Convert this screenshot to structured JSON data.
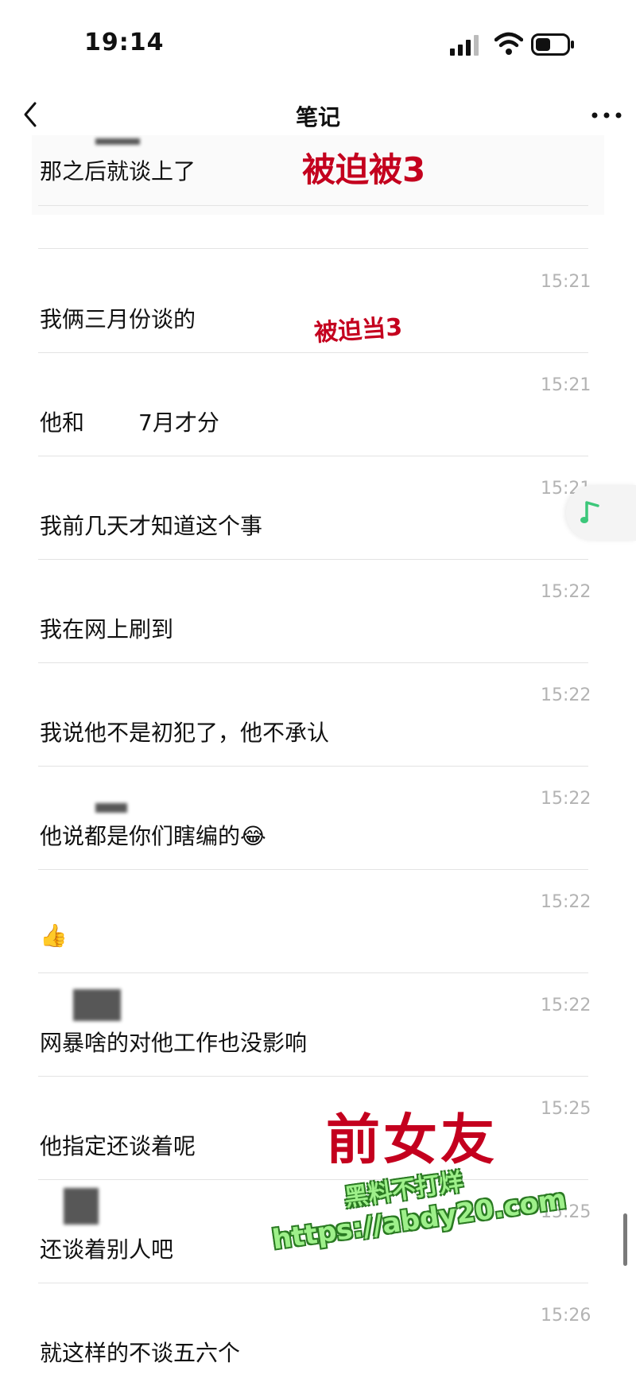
{
  "status": {
    "time": "19:14"
  },
  "nav": {
    "title": "笔记"
  },
  "top_message": {
    "text": "那之后就谈上了"
  },
  "messages": [
    {
      "time": "15:21",
      "text": "我俩三月份谈的"
    },
    {
      "time": "15:21",
      "text": "他和",
      "text_after": "7月才分"
    },
    {
      "time": "15:21",
      "text": "我前几天才知道这个事"
    },
    {
      "time": "15:22",
      "text": "我在网上刷到"
    },
    {
      "time": "15:22",
      "text": "我说他不是初犯了，他不承认"
    },
    {
      "time": "15:22",
      "text": "他说都是你们瞎编的",
      "emoji": "😂"
    },
    {
      "time": "15:22",
      "text": "",
      "emoji": "👍"
    },
    {
      "time": "15:22",
      "text": "网暴啥的对他工作也没影响"
    },
    {
      "time": "15:25",
      "text": "他指定还谈着呢"
    },
    {
      "time": "15:25",
      "text": "还谈着别人吧"
    },
    {
      "time": "15:26",
      "text": "就这样的不谈五六个"
    }
  ],
  "overlays": {
    "label_top": "被迫被3",
    "label_mid": "被迫当3",
    "label_bottom": "前女友"
  },
  "watermark": {
    "line1": "黑料不打烊",
    "line2": "https://abdy20.com"
  },
  "colors": {
    "overlay_red": "#c4001e",
    "watermark_green": "#9ef08a",
    "music_green": "#3cc77a",
    "timestamp_gray": "#b3b3b3"
  },
  "icons": [
    "back-icon",
    "more-icon",
    "signal-icon",
    "wifi-icon",
    "battery-icon",
    "music-note-icon"
  ]
}
